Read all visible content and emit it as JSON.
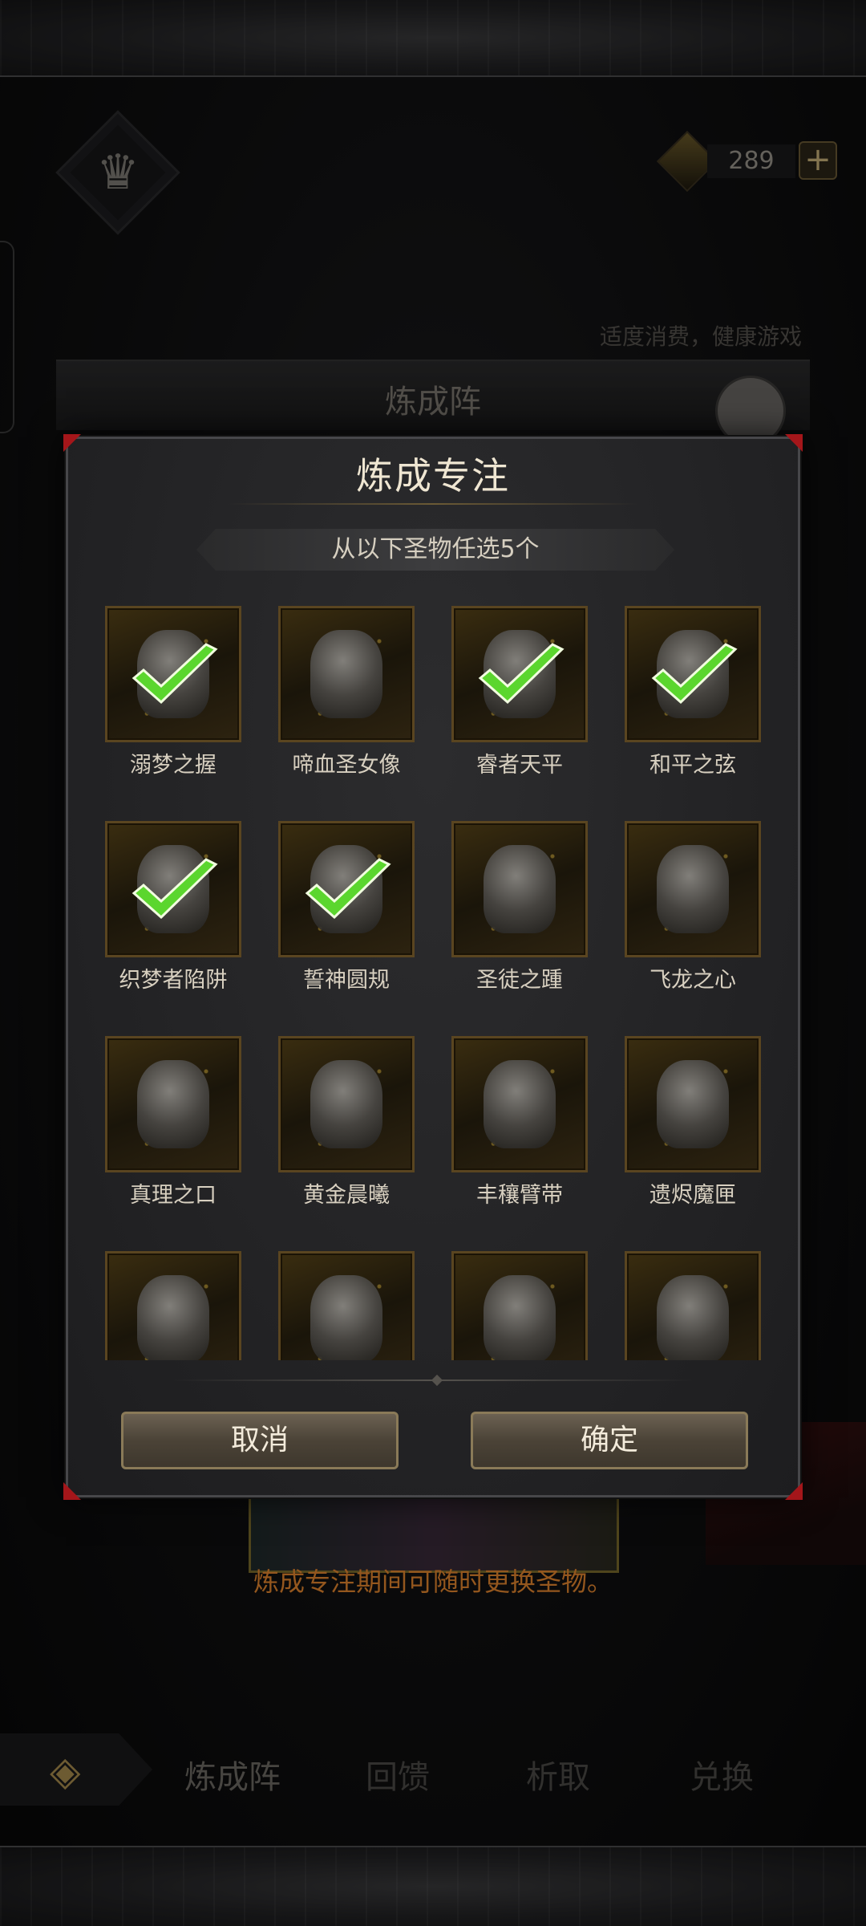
{
  "header": {
    "currency_amount": "289",
    "notice": "适度消费，健康游戏",
    "back_title": "炼成阵"
  },
  "modal": {
    "title": "炼成专注",
    "subtitle": "从以下圣物任选5个",
    "items": [
      {
        "name": "溺梦之握",
        "selected": true
      },
      {
        "name": "啼血圣女像",
        "selected": false
      },
      {
        "name": "睿者天平",
        "selected": true
      },
      {
        "name": "和平之弦",
        "selected": true
      },
      {
        "name": "织梦者陷阱",
        "selected": true
      },
      {
        "name": "誓神圆规",
        "selected": true
      },
      {
        "name": "圣徒之踵",
        "selected": false
      },
      {
        "name": "飞龙之心",
        "selected": false
      },
      {
        "name": "真理之口",
        "selected": false
      },
      {
        "name": "黄金晨曦",
        "selected": false
      },
      {
        "name": "丰穰臂带",
        "selected": false
      },
      {
        "name": "遗烬魔匣",
        "selected": false
      },
      {
        "name": "",
        "selected": false
      },
      {
        "name": "",
        "selected": false
      },
      {
        "name": "",
        "selected": false
      },
      {
        "name": "",
        "selected": false
      }
    ],
    "cancel_label": "取消",
    "confirm_label": "确定"
  },
  "hint": "炼成专注期间可随时更换圣物。",
  "nav": {
    "tabs": [
      "炼成阵",
      "回馈",
      "析取",
      "兑换"
    ],
    "active_tab": "炼成阵"
  },
  "colors": {
    "accent_orange": "#e4862e",
    "check_green": "#5bd62e",
    "corner_red": "#a4161a"
  },
  "icons": {
    "crown": "crown-icon",
    "currency": "gem-icon",
    "add": "plus-icon",
    "back": "back-arrow-icon",
    "selected": "checkmark-icon"
  }
}
